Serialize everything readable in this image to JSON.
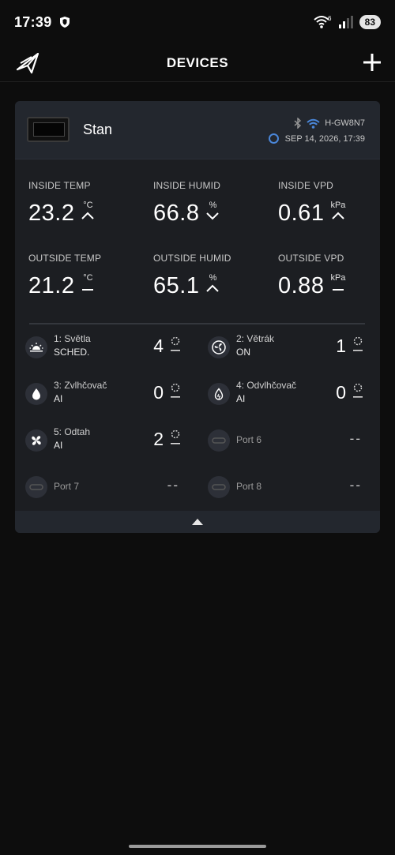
{
  "status_bar": {
    "time": "17:39",
    "battery": "83",
    "icons": [
      "shield-icon",
      "wifi-6-icon",
      "signal-icon"
    ]
  },
  "header": {
    "title": "DEVICES",
    "left_icon": "logo-icon",
    "right_icon": "plus-icon"
  },
  "device": {
    "name": "Stan",
    "id": "H-GW8N7",
    "timestamp": "SEP 14, 2026, 17:39",
    "connection_icons": [
      "bluetooth-icon",
      "wifi-icon",
      "sync-icon"
    ],
    "colors": {
      "accent": "#4a86d8"
    }
  },
  "sensors": [
    {
      "label": "INSIDE TEMP",
      "value": "23.2",
      "unit": "°C",
      "trend": "up"
    },
    {
      "label": "INSIDE HUMID",
      "value": "66.8",
      "unit": "%",
      "trend": "down"
    },
    {
      "label": "INSIDE VPD",
      "value": "0.61",
      "unit": "kPa",
      "trend": "up"
    },
    {
      "label": "OUTSIDE TEMP",
      "value": "21.2",
      "unit": "°C",
      "trend": "flat"
    },
    {
      "label": "OUTSIDE HUMID",
      "value": "65.1",
      "unit": "%",
      "trend": "up"
    },
    {
      "label": "OUTSIDE VPD",
      "value": "0.88",
      "unit": "kPa",
      "trend": "flat"
    }
  ],
  "ports": [
    {
      "name": "1: Světla",
      "mode": "SCHED.",
      "level": "4",
      "icon": "light-icon"
    },
    {
      "name": "2: Větrák",
      "mode": "ON",
      "level": "1",
      "icon": "fan-icon"
    },
    {
      "name": "3: Zvlhčovač",
      "mode": "AI",
      "level": "0",
      "icon": "drop-icon"
    },
    {
      "name": "4: Odvlhčovač",
      "mode": "AI",
      "level": "0",
      "icon": "drop-outline-icon"
    },
    {
      "name": "5: Odtah",
      "mode": "AI",
      "level": "2",
      "icon": "exhaust-fan-icon"
    },
    {
      "name": "Port 6",
      "mode": "",
      "level": "--",
      "icon": "plug-icon"
    },
    {
      "name": "Port 7",
      "mode": "",
      "level": "--",
      "icon": "plug-icon"
    },
    {
      "name": "Port 8",
      "mode": "",
      "level": "--",
      "icon": "plug-icon"
    }
  ],
  "footer": {
    "icon": "collapse-up-icon"
  }
}
